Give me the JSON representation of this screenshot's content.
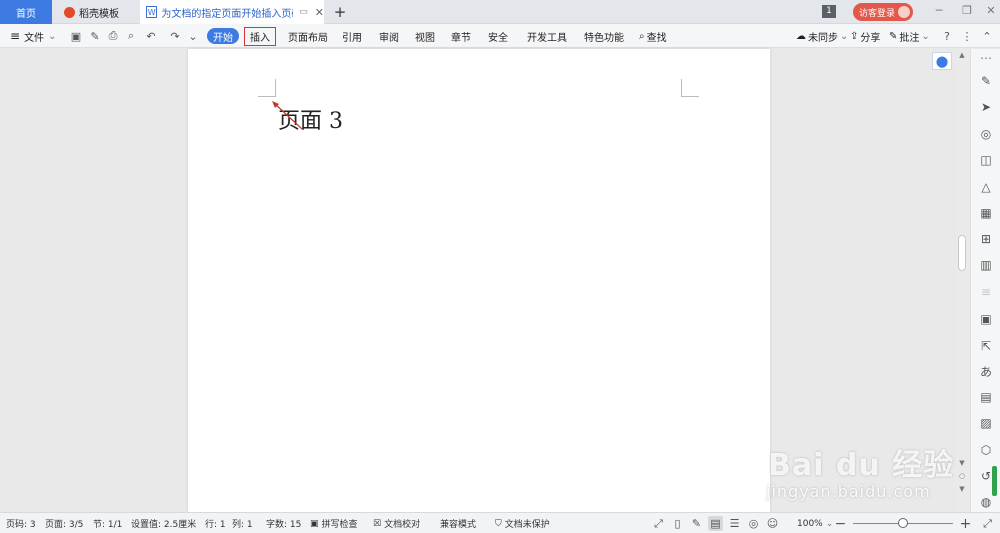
{
  "tabs": {
    "home": "首页",
    "template": "稻壳模板",
    "document": "为文档的指定页面开始插入页码",
    "add": "+"
  },
  "titlebar": {
    "notification_count": "1",
    "visitor_login": "访客登录"
  },
  "toolbar": {
    "file": "文件",
    "menu_tabs": [
      "开始",
      "插入",
      "页面布局",
      "引用",
      "审阅",
      "视图",
      "章节",
      "安全",
      "开发工具",
      "特色功能",
      "查找"
    ],
    "sync": "未同步",
    "share": "分享",
    "comment": "批注"
  },
  "document": {
    "page_text": "页面 3"
  },
  "statusbar": {
    "page_code": "页码: 3",
    "page": "页面: 3/5",
    "section": "节: 1/1",
    "setting": "设置值: 2.5厘米",
    "row": "行: 1",
    "col": "列: 1",
    "word_count": "字数: 15",
    "spell_check": "拼写检查",
    "doc_proof": "文档校对",
    "compat_mode": "兼容模式",
    "doc_protect": "文档未保护",
    "zoom": "100%"
  },
  "watermark": {
    "main": "Bai du 经验",
    "sub": "jingyan.baidu.com"
  },
  "colors": {
    "accent": "#3d7be3",
    "login": "#e2584a",
    "highlight_border": "#dd3333"
  }
}
